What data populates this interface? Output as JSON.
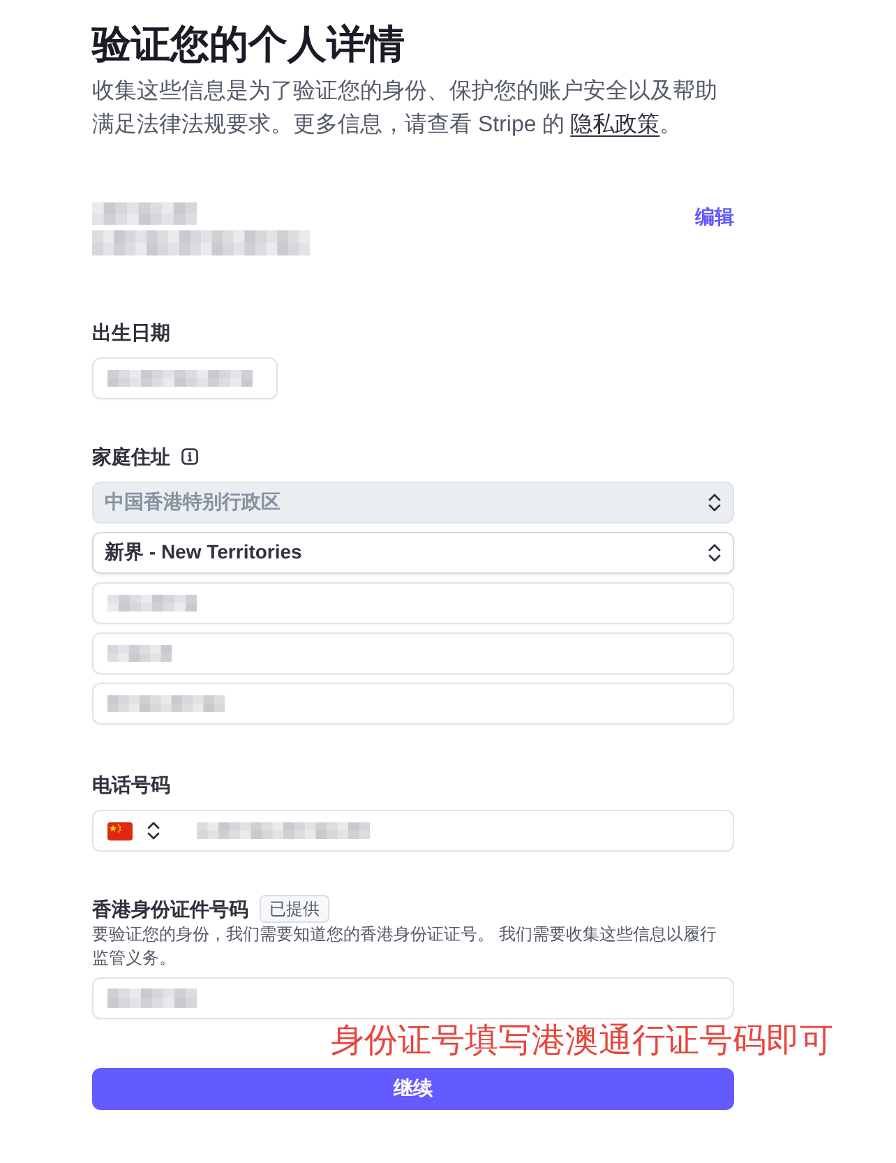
{
  "heading": "验证您的个人详情",
  "intro": {
    "text": "收集这些信息是为了验证您的身份、保护您的账户安全以及帮助满足法律法规要求。更多信息，请查看 Stripe 的",
    "link": "隐私政策",
    "suffix": "。"
  },
  "account": {
    "name_redacted": true,
    "email_redacted": true,
    "edit_link": "编辑"
  },
  "birth_date": {
    "label": "出生日期",
    "redacted": true
  },
  "address": {
    "label": "家庭住址",
    "country": {
      "value": "中国香港特别行政区",
      "disabled": true
    },
    "region": {
      "value": "新界 - New Territories",
      "disabled": false
    },
    "lines": [
      {
        "redacted": true
      },
      {
        "redacted": true
      },
      {
        "redacted": true
      }
    ]
  },
  "phone": {
    "label": "电话号码",
    "redacted": true
  },
  "id_number": {
    "label": "香港身份证件号码",
    "badge": "已提供",
    "description": "要验证您的身份，我们需要知道您的香港身份证证号。 我们需要收集这些信息以履行监管义务。",
    "redacted": true
  },
  "annotation": "身份证号填写港澳通行证号码即可",
  "submit_button": "继续"
}
